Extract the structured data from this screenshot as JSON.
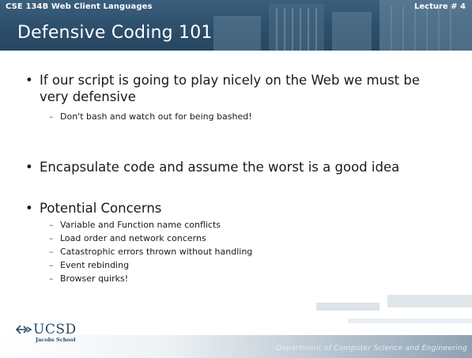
{
  "header": {
    "course": "CSE 134B  Web Client Languages",
    "lecture": "Lecture # 4",
    "title": "Defensive Coding 101"
  },
  "bullets": [
    {
      "text": "If our script is going to play nicely on the Web we must be very defensive",
      "subs": [
        "Don't bash and watch out for being bashed!"
      ]
    },
    {
      "text": "Encapsulate code and assume the worst is a good idea",
      "subs": []
    },
    {
      "text": "Potential Concerns",
      "subs": [
        "Variable and Function name conflicts",
        "Load order and network concerns",
        "Catastrophic errors thrown without handling",
        "Event rebinding",
        "Browser quirks!"
      ]
    }
  ],
  "footer": {
    "logo": "UCSD",
    "logo_sub": "Jacobs School",
    "department": "Department of Computer Science and Engineering"
  }
}
